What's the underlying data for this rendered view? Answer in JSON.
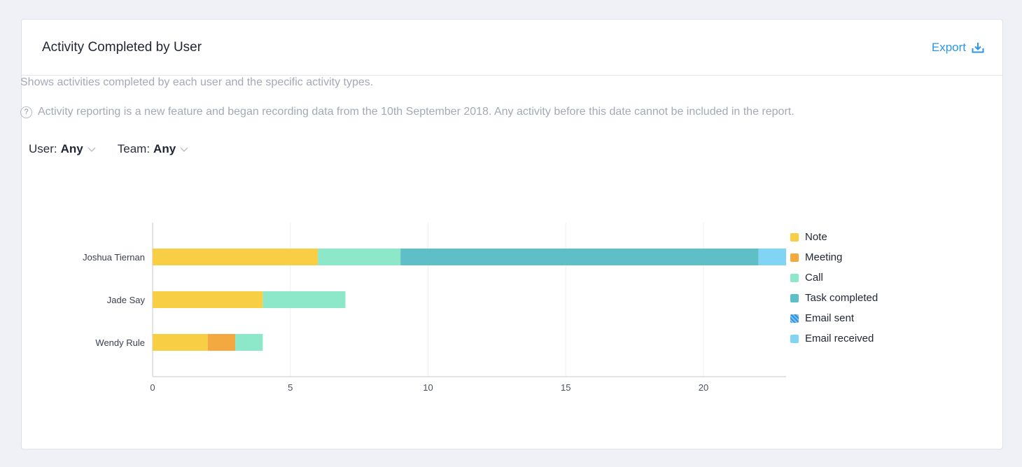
{
  "header": {
    "title": "Activity Completed by User",
    "export_label": "Export",
    "export_icon": "download-icon"
  },
  "description": "Shows activities completed by each user and the specific activity types.",
  "notice": {
    "icon": "help-icon",
    "icon_glyph": "?",
    "text": "Activity reporting is a new feature and began recording data from the 10th September 2018. Any activity before this date cannot be included in the report."
  },
  "filters": [
    {
      "label": "User:",
      "value": "Any"
    },
    {
      "label": "Team:",
      "value": "Any"
    }
  ],
  "chart_data": {
    "type": "bar",
    "orientation": "horizontal",
    "stacked": true,
    "title": "",
    "xlabel": "",
    "ylabel": "",
    "xlim": [
      0,
      23
    ],
    "x_ticks": [
      0,
      5,
      10,
      15,
      20
    ],
    "grid": true,
    "legend_position": "right",
    "categories": [
      "Joshua Tiernan",
      "Jade Say",
      "Wendy Rule"
    ],
    "series": [
      {
        "name": "Note",
        "color": "#f8cf44",
        "values": [
          6,
          4,
          2
        ]
      },
      {
        "name": "Meeting",
        "color": "#f3a93f",
        "values": [
          0,
          0,
          1
        ]
      },
      {
        "name": "Call",
        "color": "#8de8c9",
        "values": [
          3,
          3,
          1
        ]
      },
      {
        "name": "Task completed",
        "color": "#5fbfc6",
        "values": [
          13,
          0,
          0
        ]
      },
      {
        "name": "Email sent",
        "color": "#2b8fe6",
        "pattern": "hatched",
        "values": [
          0,
          0,
          0
        ]
      },
      {
        "name": "Email received",
        "color": "#81d4f3",
        "values": [
          1,
          0,
          0
        ]
      }
    ]
  }
}
